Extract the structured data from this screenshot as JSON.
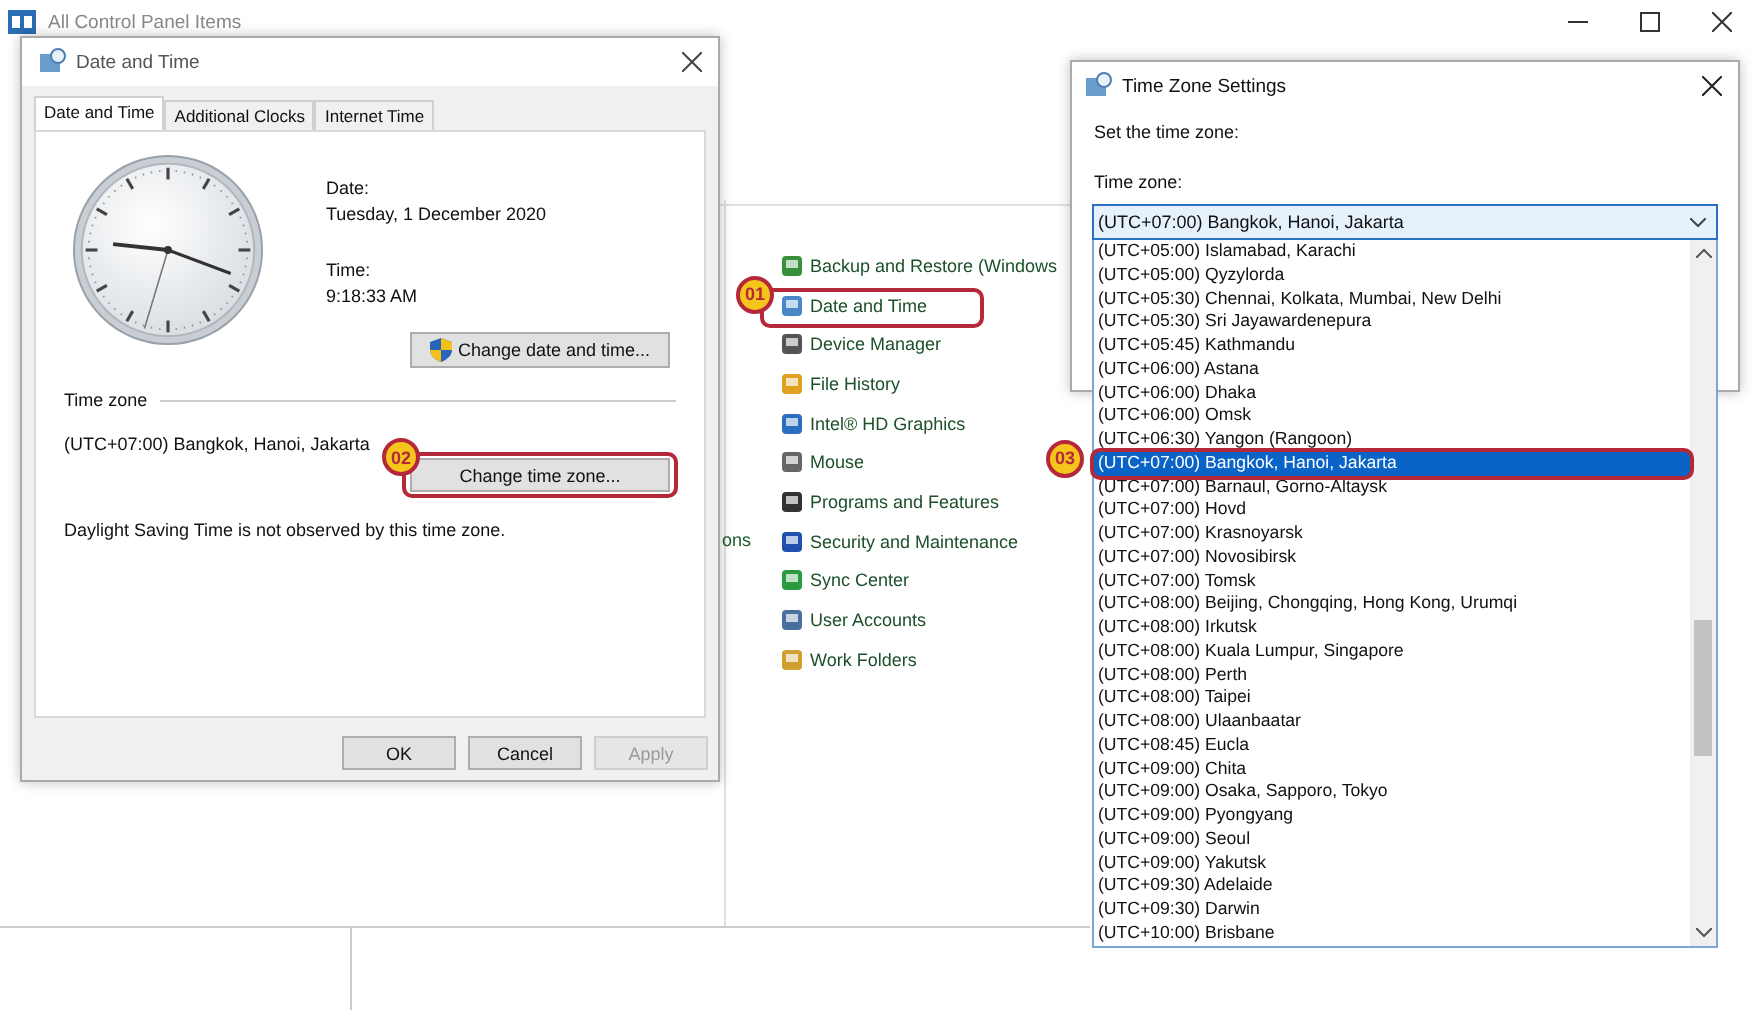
{
  "background_window": {
    "title": "All Control Panel Items",
    "cut_text": "ons",
    "items": [
      {
        "label": "Backup and Restore (Windows"
      },
      {
        "label": "Date and Time",
        "step": "01"
      },
      {
        "label": "Device Manager"
      },
      {
        "label": "File History"
      },
      {
        "label": "Intel® HD Graphics"
      },
      {
        "label": "Mouse"
      },
      {
        "label": "Programs and Features"
      },
      {
        "label": "Security and Maintenance"
      },
      {
        "label": "Sync Center"
      },
      {
        "label": "User Accounts"
      },
      {
        "label": "Work Folders"
      }
    ]
  },
  "date_time_dialog": {
    "title": "Date and Time",
    "tabs": [
      {
        "label": "Date and Time",
        "selected": true
      },
      {
        "label": "Additional Clocks",
        "selected": false
      },
      {
        "label": "Internet Time",
        "selected": false
      }
    ],
    "date_label": "Date:",
    "date": "Tuesday, 1 December 2020",
    "time_label": "Time:",
    "time": "9:18:33 AM",
    "change_date_button": "Change date and time...",
    "time_zone_heading": "Time zone",
    "time_zone": "(UTC+07:00) Bangkok, Hanoi, Jakarta",
    "change_zone_button": {
      "label": "Change time zone...",
      "step": "02"
    },
    "dst_note": "Daylight Saving Time is not observed by this time zone.",
    "buttons": [
      {
        "label": "OK",
        "disabled": false
      },
      {
        "label": "Cancel",
        "disabled": false
      },
      {
        "label": "Apply",
        "disabled": true
      }
    ]
  },
  "time_zone_dialog": {
    "title": "Time Zone Settings",
    "prompt": "Set the time zone:",
    "field_label": "Time zone:",
    "value": "(UTC+07:00) Bangkok, Hanoi, Jakarta",
    "options": [
      {
        "label": "(UTC+05:00) Islamabad, Karachi",
        "selected": false
      },
      {
        "label": "(UTC+05:00) Qyzylorda",
        "selected": false
      },
      {
        "label": "(UTC+05:30) Chennai, Kolkata, Mumbai, New Delhi",
        "selected": false
      },
      {
        "label": "(UTC+05:30) Sri Jayawardenepura",
        "selected": false
      },
      {
        "label": "(UTC+05:45) Kathmandu",
        "selected": false
      },
      {
        "label": "(UTC+06:00) Astana",
        "selected": false
      },
      {
        "label": "(UTC+06:00) Dhaka",
        "selected": false
      },
      {
        "label": "(UTC+06:00) Omsk",
        "selected": false
      },
      {
        "label": "(UTC+06:30) Yangon (Rangoon)",
        "selected": false
      },
      {
        "label": "(UTC+07:00) Bangkok, Hanoi, Jakarta",
        "selected": true,
        "step": "03"
      },
      {
        "label": "(UTC+07:00) Barnaul, Gorno-Altaysk",
        "selected": false
      },
      {
        "label": "(UTC+07:00) Hovd",
        "selected": false
      },
      {
        "label": "(UTC+07:00) Krasnoyarsk",
        "selected": false
      },
      {
        "label": "(UTC+07:00) Novosibirsk",
        "selected": false
      },
      {
        "label": "(UTC+07:00) Tomsk",
        "selected": false
      },
      {
        "label": "(UTC+08:00) Beijing, Chongqing, Hong Kong, Urumqi",
        "selected": false
      },
      {
        "label": "(UTC+08:00) Irkutsk",
        "selected": false
      },
      {
        "label": "(UTC+08:00) Kuala Lumpur, Singapore",
        "selected": false
      },
      {
        "label": "(UTC+08:00) Perth",
        "selected": false
      },
      {
        "label": "(UTC+08:00) Taipei",
        "selected": false
      },
      {
        "label": "(UTC+08:00) Ulaanbaatar",
        "selected": false
      },
      {
        "label": "(UTC+08:45) Eucla",
        "selected": false
      },
      {
        "label": "(UTC+09:00) Chita",
        "selected": false
      },
      {
        "label": "(UTC+09:00) Osaka, Sapporo, Tokyo",
        "selected": false
      },
      {
        "label": "(UTC+09:00) Pyongyang",
        "selected": false
      },
      {
        "label": "(UTC+09:00) Seoul",
        "selected": false
      },
      {
        "label": "(UTC+09:00) Yakutsk",
        "selected": false
      },
      {
        "label": "(UTC+09:30) Adelaide",
        "selected": false
      },
      {
        "label": "(UTC+09:30) Darwin",
        "selected": false
      },
      {
        "label": "(UTC+10:00) Brisbane",
        "selected": false
      }
    ]
  }
}
